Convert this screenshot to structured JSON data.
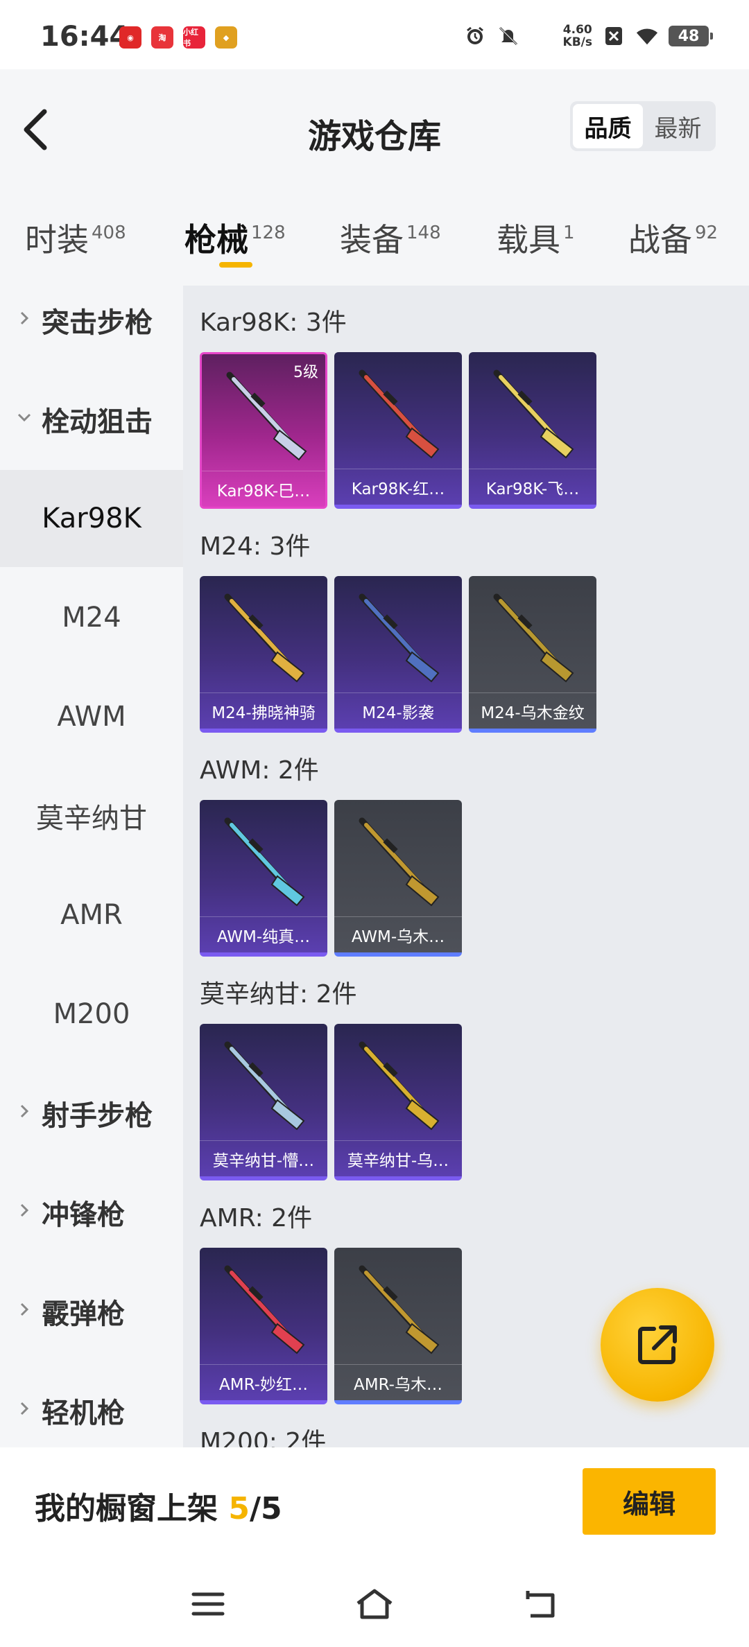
{
  "status_bar": {
    "time": "16:44",
    "net_speed_value": "4.60",
    "net_speed_unit": "KB/s",
    "battery": "48",
    "notifications": [
      {
        "name": "netease-music-icon",
        "color": "#e02828",
        "glyph": "◉"
      },
      {
        "name": "taobao-icon",
        "color": "#e8343a",
        "glyph": "淘"
      },
      {
        "name": "xiaohongshu-icon",
        "color": "#e8243a",
        "glyph": "小红书"
      },
      {
        "name": "game-app-icon",
        "color": "#e0a020",
        "glyph": "◆"
      }
    ]
  },
  "header": {
    "title": "游戏仓库",
    "sort_quality": "品质",
    "sort_latest": "最新"
  },
  "tabs": [
    {
      "label": "时装",
      "count": "408"
    },
    {
      "label": "枪械",
      "count": "128"
    },
    {
      "label": "装备",
      "count": "148"
    },
    {
      "label": "载具",
      "count": "1"
    },
    {
      "label": "战备",
      "count": "92"
    }
  ],
  "sidebar": {
    "items": [
      {
        "label": "突击步枪",
        "type": "group",
        "expanded": false
      },
      {
        "label": "栓动狙击",
        "type": "group",
        "expanded": true
      },
      {
        "label": "Kar98K",
        "type": "sub",
        "selected": true
      },
      {
        "label": "M24",
        "type": "sub"
      },
      {
        "label": "AWM",
        "type": "sub"
      },
      {
        "label": "莫辛纳甘",
        "type": "sub"
      },
      {
        "label": "AMR",
        "type": "sub"
      },
      {
        "label": "M200",
        "type": "sub"
      },
      {
        "label": "射手步枪",
        "type": "group",
        "expanded": false
      },
      {
        "label": "冲锋枪",
        "type": "group",
        "expanded": false
      },
      {
        "label": "霰弹枪",
        "type": "group",
        "expanded": false
      },
      {
        "label": "轻机枪",
        "type": "group",
        "expanded": false
      }
    ]
  },
  "sections": [
    {
      "title": "Kar98K: 3件",
      "items": [
        {
          "label": "Kar98K-巳…",
          "rarity": "pink",
          "level": "5级",
          "gun": "#c8d0e8"
        },
        {
          "label": "Kar98K-红…",
          "rarity": "purple",
          "gun": "#d85040"
        },
        {
          "label": "Kar98K-飞…",
          "rarity": "purple",
          "gun": "#e8d060"
        }
      ]
    },
    {
      "title": "M24: 3件",
      "items": [
        {
          "label": "M24-拂晓神骑",
          "rarity": "purple",
          "gun": "#e0b040"
        },
        {
          "label": "M24-影袭",
          "rarity": "purple",
          "gun": "#5070c0"
        },
        {
          "label": "M24-乌木金纹",
          "rarity": "grey",
          "gun": "#b89830"
        }
      ]
    },
    {
      "title": "AWM: 2件",
      "items": [
        {
          "label": "AWM-纯真…",
          "rarity": "purple",
          "gun": "#60c8e0"
        },
        {
          "label": "AWM-乌木…",
          "rarity": "grey",
          "gun": "#c09830"
        }
      ]
    },
    {
      "title": "莫辛纳甘: 2件",
      "items": [
        {
          "label": "莫辛纳甘-懵…",
          "rarity": "purple",
          "gun": "#a8c8e0"
        },
        {
          "label": "莫辛纳甘-乌…",
          "rarity": "purple",
          "gun": "#d8b030"
        }
      ]
    },
    {
      "title": "AMR: 2件",
      "items": [
        {
          "label": "AMR-妙红…",
          "rarity": "purple",
          "gun": "#e04050"
        },
        {
          "label": "AMR-乌木…",
          "rarity": "grey",
          "gun": "#c09830"
        }
      ]
    },
    {
      "title": "M200: 2件",
      "items": []
    }
  ],
  "bottom": {
    "showcase_prefix": "我的橱窗上架 ",
    "showcase_current": "5",
    "showcase_total": "/5",
    "edit_label": "编辑"
  },
  "colors": {
    "accent": "#f5b400",
    "purple_rarity": "#7a5bf0",
    "pink_rarity": "#e646c9"
  }
}
